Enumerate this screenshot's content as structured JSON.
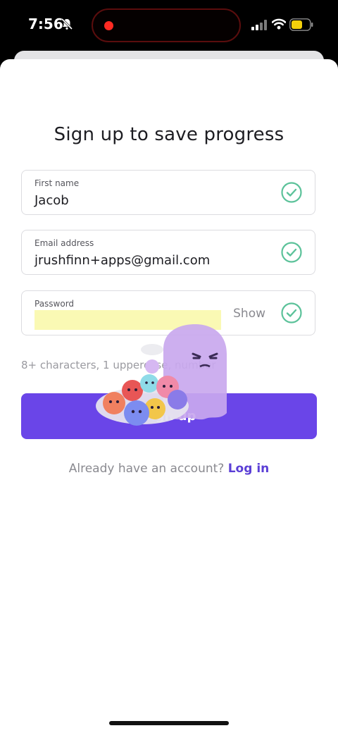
{
  "status_bar": {
    "time": "7:56",
    "icons": [
      "bell-slash-icon",
      "signal-icon",
      "wifi-icon",
      "battery-icon"
    ],
    "battery_color": "#f4d00b",
    "recording_color": "#ff2a22"
  },
  "form": {
    "title": "Sign up to save progress",
    "first_name": {
      "label": "First name",
      "value": "Jacob"
    },
    "email": {
      "label": "Email address",
      "value": "jrushfinn+apps@gmail.com"
    },
    "password": {
      "label": "Password",
      "value": "",
      "show_label": "Show"
    },
    "password_hint": "8+ characters, 1 uppercase, number",
    "submit_label": "Sign up",
    "login_prompt": "Already have an account?",
    "login_link": "Log in"
  },
  "colors": {
    "accent": "#6a45e8",
    "check": "#5cc29a",
    "link": "#5b3fd6"
  }
}
